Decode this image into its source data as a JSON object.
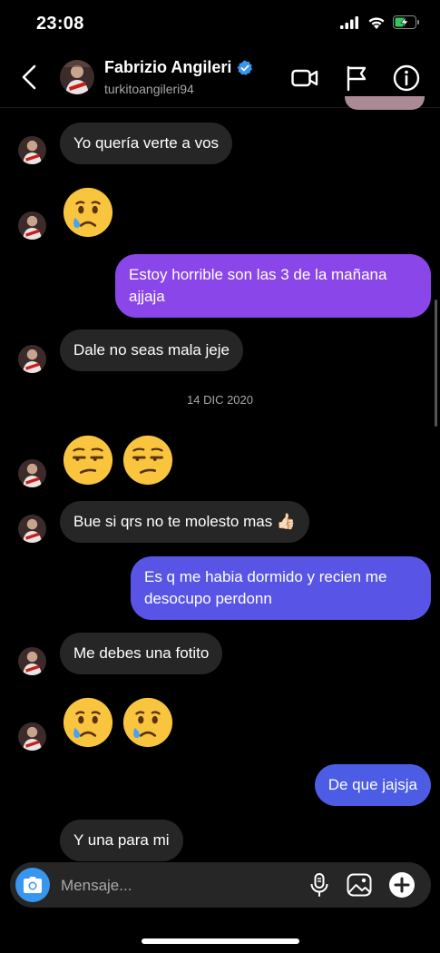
{
  "status_bar": {
    "time": "23:08",
    "icons": [
      "signal-icon",
      "wifi-icon",
      "battery-charging-icon"
    ]
  },
  "header": {
    "name": "Fabrizio Angileri",
    "username": "turkitoangileri94",
    "verified": true,
    "icons": [
      "back-chevron-icon",
      "video-call-icon",
      "flag-icon",
      "info-icon"
    ]
  },
  "messages": [
    {
      "from": "them",
      "type": "text",
      "text": "Yo quería verte a vos"
    },
    {
      "from": "them",
      "type": "emoji",
      "emoji": "😢"
    },
    {
      "from": "me",
      "type": "text",
      "lines": [
        "Estoy horrible son las 3 de la mañana",
        "ajjaja"
      ]
    },
    {
      "from": "them",
      "type": "text",
      "text": "Dale no seas mala jeje"
    },
    {
      "type": "date",
      "text": "14 DIC 2020"
    },
    {
      "from": "them",
      "type": "emoji",
      "emoji": "😒😒"
    },
    {
      "from": "them",
      "type": "text",
      "text": "Bue si qrs no te molesto mas 👍🏻"
    },
    {
      "from": "me",
      "type": "text",
      "lines": [
        "Es q me habia dormido y recien me",
        "desocupo perdonn"
      ]
    },
    {
      "from": "them",
      "type": "text",
      "text": "Me debes una fotito"
    },
    {
      "from": "them",
      "type": "emoji",
      "emoji": "😢😢"
    },
    {
      "from": "me",
      "type": "text",
      "text": "De que jajsja"
    },
    {
      "from": "them",
      "type": "text",
      "text": "Y una para mi"
    }
  ],
  "composer": {
    "placeholder": "Mensaje...",
    "icons": [
      "camera-icon",
      "microphone-icon",
      "gallery-icon",
      "add-icon"
    ]
  },
  "colors": {
    "background": "#000000",
    "incoming_bubble": "#262626",
    "outgoing_top": "#8a46e8",
    "outgoing_bottom": "#4c5ce4",
    "accent": "#3797f0"
  }
}
